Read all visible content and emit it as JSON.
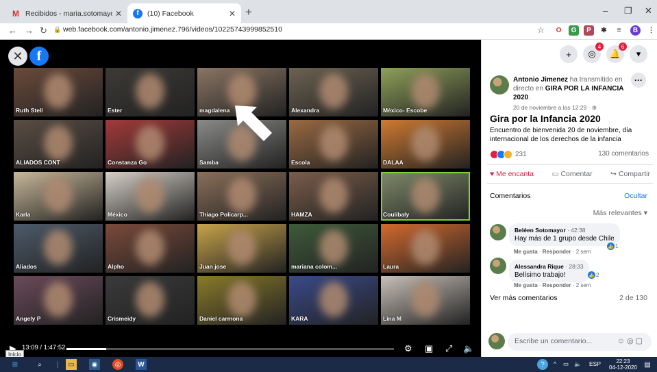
{
  "browser": {
    "tabs": [
      {
        "title": "Recibidos - maria.sotomayor@u",
        "icon": "gmail-icon",
        "active": false
      },
      {
        "title": "(10) Facebook",
        "icon": "facebook-icon",
        "active": true
      }
    ],
    "new_tab": "+",
    "url": "web.facebook.com/antonio.jimenez.796/videos/10225743999852510",
    "window_controls": {
      "minimize": "–",
      "maximize": "❐",
      "close": "✕"
    }
  },
  "video": {
    "participants": [
      {
        "name": "Ruth Stell",
        "bg": "#6b4a3b"
      },
      {
        "name": "Ester",
        "bg": "#3d3a36"
      },
      {
        "name": "magdalena",
        "bg": "#8a7564"
      },
      {
        "name": "Alexandra",
        "bg": "#6d6252"
      },
      {
        "name": "México- Escobe",
        "bg": "#8fa05a"
      },
      {
        "name": "ALIADOS CONT",
        "bg": "#5a4d43"
      },
      {
        "name": "Constanza Go",
        "bg": "#a33a3a"
      },
      {
        "name": "Samba",
        "bg": "#8a8a88"
      },
      {
        "name": "Escola",
        "bg": "#9a6a42"
      },
      {
        "name": "DALAA",
        "bg": "#d07a30"
      },
      {
        "name": "Karla",
        "bg": "#c8b89a"
      },
      {
        "name": "México",
        "bg": "#d6d0c8"
      },
      {
        "name": "Thiago Policarp...",
        "bg": "#8b6f5a"
      },
      {
        "name": "HAMZA",
        "bg": "#7a5d4a"
      },
      {
        "name": "Coulibaly",
        "bg": "#7f8a6a"
      },
      {
        "name": "Aliados",
        "bg": "#4d5a6a"
      },
      {
        "name": "Alpho",
        "bg": "#7a4a3a"
      },
      {
        "name": "Juan jose",
        "bg": "#c7a34a"
      },
      {
        "name": "mariana colom...",
        "bg": "#3e5a3a"
      },
      {
        "name": "Laura",
        "bg": "#d46a2e"
      },
      {
        "name": "Angely P",
        "bg": "#6a4a5a"
      },
      {
        "name": "Crismeidy",
        "bg": "#3a3a3a"
      },
      {
        "name": "Daniel carmona",
        "bg": "#8a7a2a"
      },
      {
        "name": "KARA",
        "bg": "#3a4a8a"
      },
      {
        "name": "Lina M",
        "bg": "#c8c0b8"
      }
    ],
    "time": "13:09 / 1:47:52",
    "progress_fraction": 0.121,
    "tooltip": "Inicio"
  },
  "post": {
    "author": "Antonio Jimenez",
    "action": " ha transmitido en directo en ",
    "group": "GIRA POR LA INFANCIA 2020",
    "date": "20 de noviembre a las 12:29 · ⊕",
    "title": "Gira por la Infancia 2020",
    "description": "Encuentro de bienvenida 20 de noviembre, día internacional de los derechos de la infancia",
    "reactions": "231",
    "comments_count": "130 comentarios",
    "like_label": "Me encanta",
    "comment_label": "Comentar",
    "share_label": "Compartir"
  },
  "comments": {
    "heading": "Comentarios",
    "hide": "Ocultar",
    "sort": "Más relevantes ▾",
    "items": [
      {
        "author": "Beléen Sotomayor",
        "time": " · 42:38",
        "text": "Hay más de 1 grupo desde Chile",
        "likes": "1",
        "meta_like": "Me gusta",
        "meta_reply": "Responder",
        "meta_time": " · 2 sem"
      },
      {
        "author": "Alessandra Rique",
        "time": " · 28:33",
        "text": "Belísimo trabajo!",
        "likes": "2",
        "meta_like": "Me gusta",
        "meta_reply": "Responder",
        "meta_time": " · 2 sem"
      }
    ],
    "more": "Ver más comentarios",
    "pages": "2 de 130",
    "write_placeholder": "Escribe un comentario..."
  },
  "notifications": {
    "messenger": "4",
    "alerts": "6"
  },
  "taskbar": {
    "lang": "ESP",
    "time": "22:23",
    "date": "04-12-2020"
  }
}
